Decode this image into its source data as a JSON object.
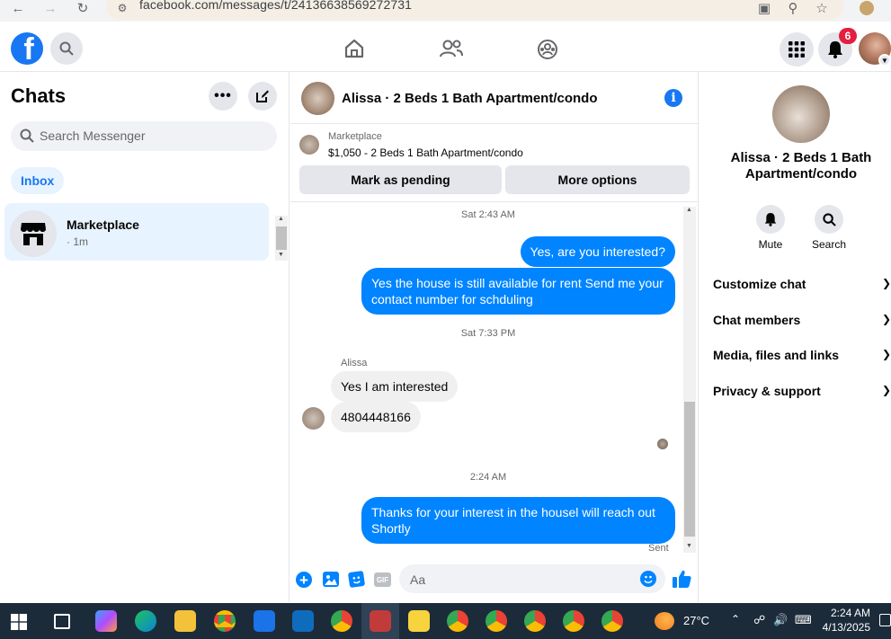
{
  "browser": {
    "url": "facebook.com/messages/t/24136638569272731"
  },
  "header": {
    "notification_count": "6"
  },
  "sidebar": {
    "title": "Chats",
    "search_placeholder": "Search Messenger",
    "filter_inbox": "Inbox",
    "conversations": [
      {
        "name": "Marketplace",
        "time": "· 1m"
      }
    ]
  },
  "conversation": {
    "title": "Alissa · 2 Beds 1 Bath Apartment/condo",
    "listing_source": "Marketplace",
    "listing_title": "$1,050 - 2 Beds 1 Bath Apartment/condo",
    "mark_pending": "Mark as pending",
    "more_options": "More options",
    "messages": [
      {
        "type": "timestamp",
        "text": "Sat 2:43 AM"
      },
      {
        "type": "me",
        "text": "Yes, are you interested?"
      },
      {
        "type": "me",
        "text": "Yes the house is still available for rent Send me your contact number for schduling"
      },
      {
        "type": "timestamp",
        "text": "Sat 7:33 PM"
      },
      {
        "type": "sender",
        "text": "Alissa"
      },
      {
        "type": "them",
        "text": "Yes I am interested"
      },
      {
        "type": "them",
        "text": "4804448166"
      },
      {
        "type": "timestamp",
        "text": "2:24 AM"
      },
      {
        "type": "me",
        "text": "Thanks for your interest in the housel will reach out Shortly"
      },
      {
        "type": "status",
        "text": "Sent"
      }
    ],
    "composer_placeholder": "Aa"
  },
  "details": {
    "name": "Alissa · 2 Beds 1 Bath Apartment/condo",
    "mute": "Mute",
    "search": "Search",
    "sections": [
      "Customize chat",
      "Chat members",
      "Media, files and links",
      "Privacy & support"
    ]
  },
  "taskbar": {
    "weather_temp": "27°C",
    "time": "2:24 AM",
    "date": "4/13/2025"
  },
  "colors": {
    "brand": "#1877f2",
    "bubble_me": "#0084ff",
    "bubble_them": "#f0f0f0",
    "badge": "#e41e3f"
  }
}
